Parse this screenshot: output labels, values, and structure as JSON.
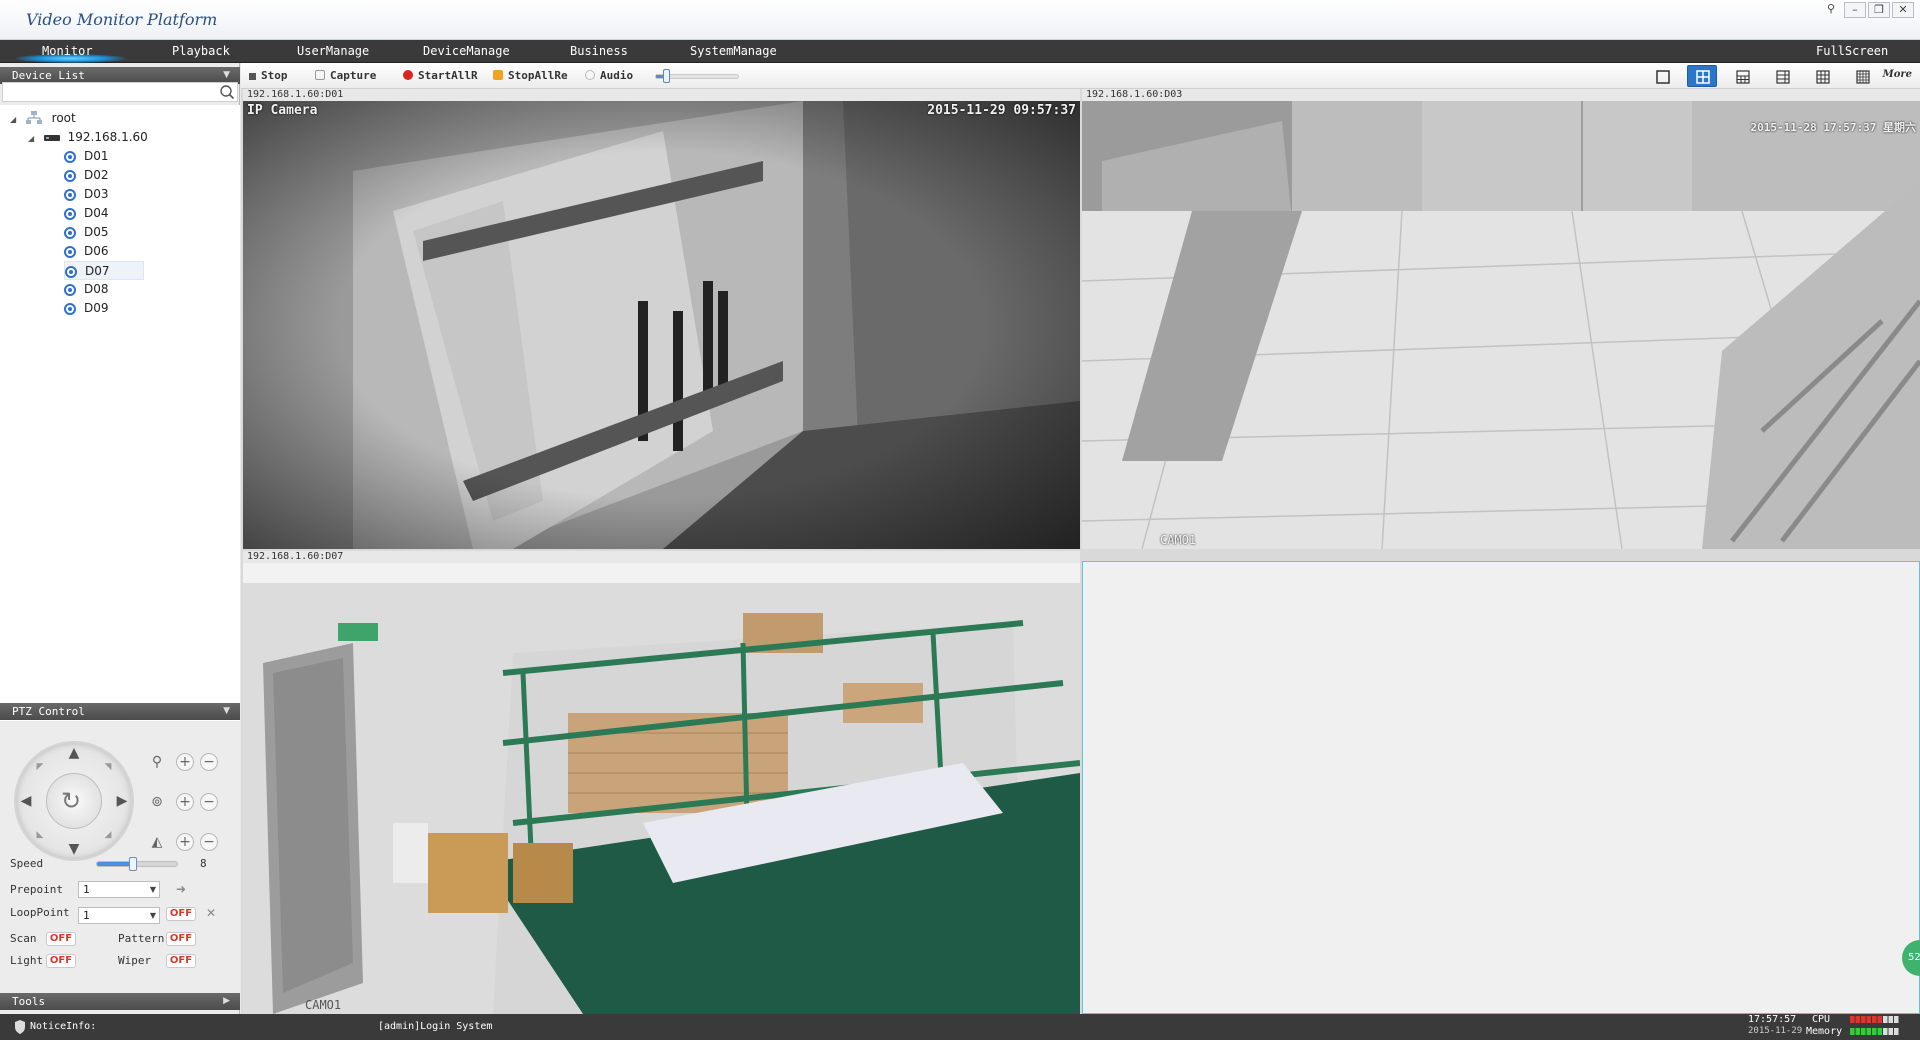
{
  "app": {
    "title": "Video Monitor Platform"
  },
  "window_controls": {
    "pin": "⚲",
    "minimize": "–",
    "maximize": "❐",
    "close": "✕"
  },
  "menu": {
    "items": [
      "Monitor",
      "Playback",
      "UserManage",
      "DeviceManage",
      "Business",
      "SystemManage"
    ],
    "fullscreen": "FullScreen",
    "active": "Monitor"
  },
  "sidebar": {
    "device_list_title": "Device List",
    "search_placeholder": "",
    "tree": {
      "root": "root",
      "host": "192.168.1.60",
      "channels": [
        "D01",
        "D02",
        "D03",
        "D04",
        "D05",
        "D06",
        "D07",
        "D08",
        "D09"
      ],
      "selected": "D07"
    },
    "ptz_title": "PTZ Control",
    "ptz": {
      "speed_label": "Speed",
      "speed_value": "8",
      "speed_level": 0.45,
      "prepoint_label": "Prepoint",
      "prepoint_value": "1",
      "loop_label": "LoopPoint",
      "loop_value": "1",
      "loop_state": "OFF",
      "scan_label": "Scan",
      "scan_state": "OFF",
      "pattern_label": "Pattern",
      "pattern_state": "OFF",
      "light_label": "Light",
      "light_state": "OFF",
      "wiper_label": "Wiper",
      "wiper_state": "OFF"
    },
    "tools_title": "Tools"
  },
  "toolbar": {
    "stop": "Stop",
    "capture": "Capture",
    "start_all": "StartAllR",
    "stop_all": "StopAllRe",
    "audio": "Audio",
    "volume_level": 0.12,
    "more": "More",
    "active_layout": "quad"
  },
  "panes": [
    {
      "label": "192.168.1.60:D01",
      "osd_top_left": "IP Camera",
      "osd_top_right": "2015-11-29 09:57:37",
      "osd_bottom": ""
    },
    {
      "label": "192.168.1.60:D03",
      "osd_top_left": "",
      "osd_top_right": "2015-11-28 17:57:37 星期六",
      "osd_bottom": "CAMO1"
    },
    {
      "label": "192.168.1.60:D07",
      "osd_top_left": "",
      "osd_top_right": "",
      "osd_bottom": "CAMO1"
    },
    {
      "label": "",
      "osd_top_left": "",
      "osd_top_right": "",
      "osd_bottom": ""
    }
  ],
  "statusbar": {
    "notice_label": "NoticeInfo:",
    "notice_text": "[admin]Login System",
    "time": "17:57:57",
    "date": "2015-11-29",
    "cpu_label": "CPU",
    "memory_label": "Memory",
    "cpu_color": "#e2332a",
    "memory_color": "#2fcf3a"
  },
  "side_badge": "52"
}
